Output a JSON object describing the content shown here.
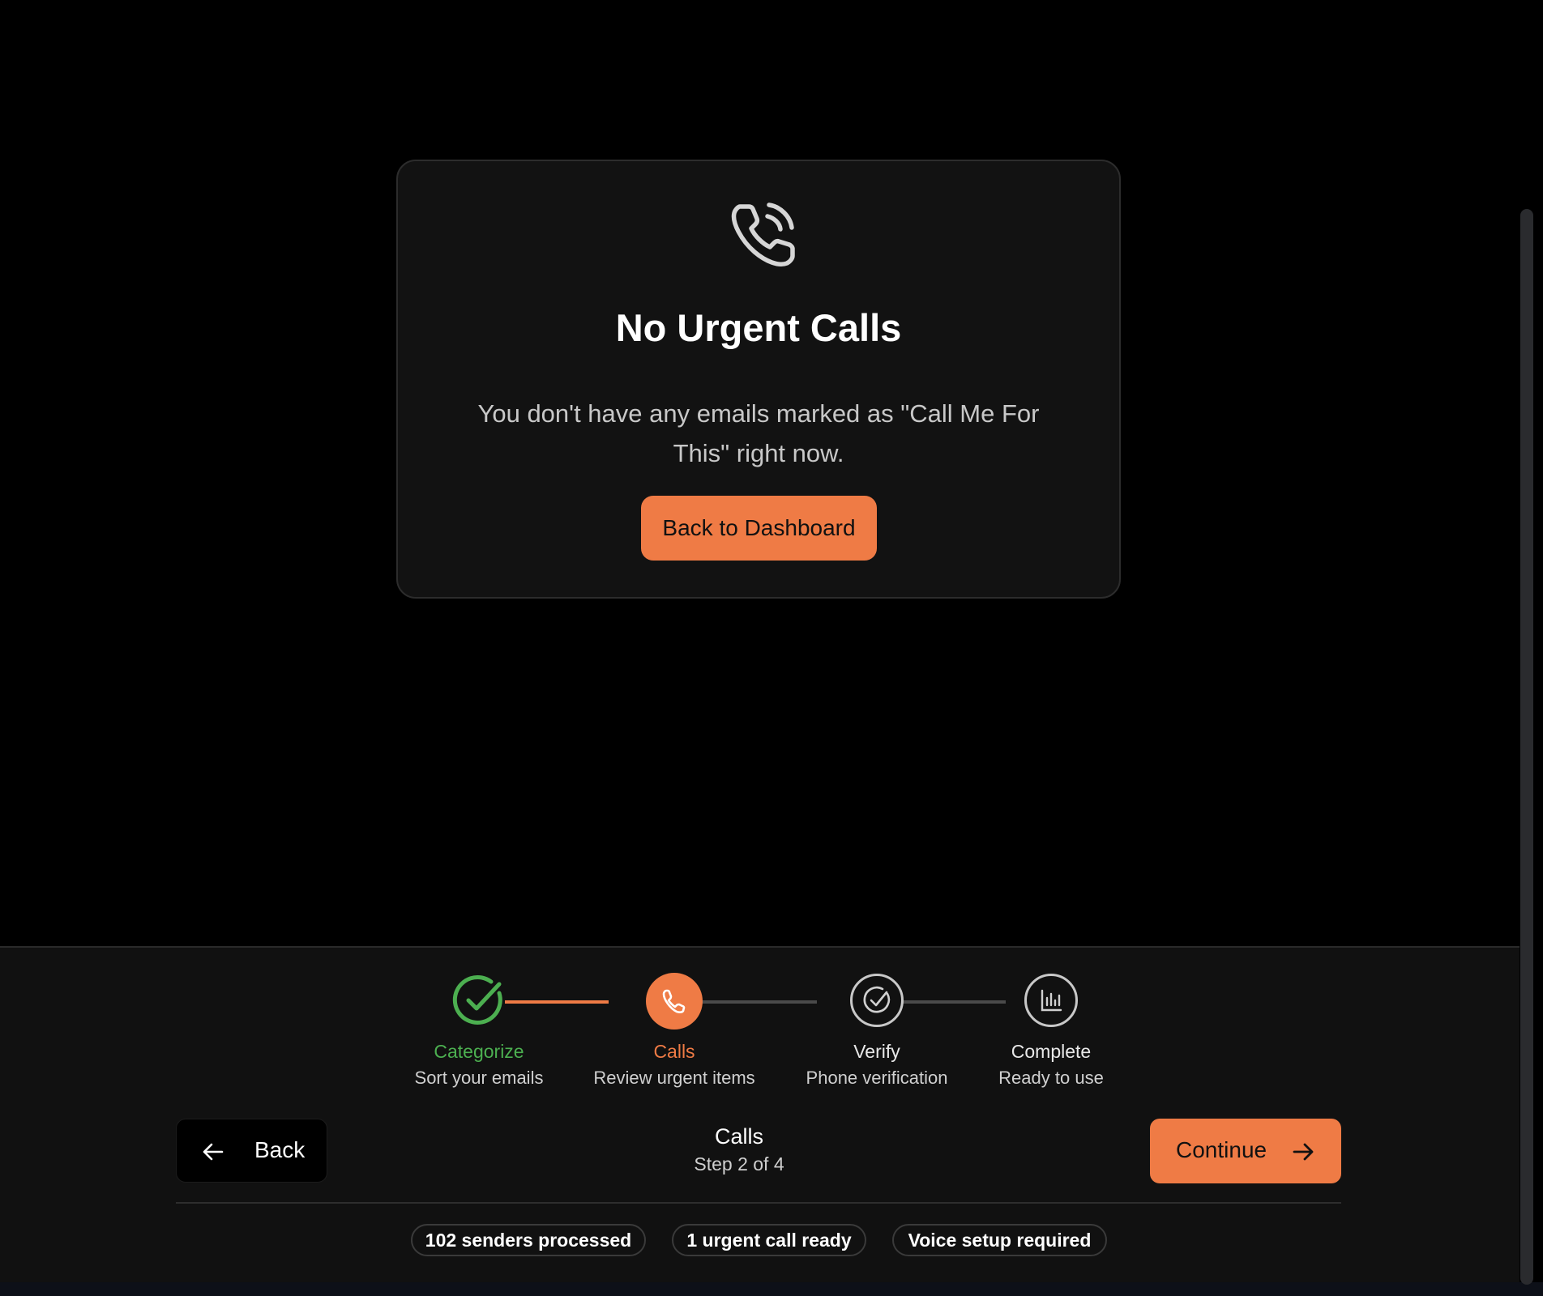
{
  "card": {
    "icon": "phone-call-icon",
    "title": "No Urgent Calls",
    "body": "You don't have any emails marked as \"Call Me For This\" right now.",
    "button_label": "Back to Dashboard"
  },
  "stepper": {
    "steps": [
      {
        "name": "Categorize",
        "description": "Sort your emails",
        "icon": "check-circle-icon",
        "state": "completed"
      },
      {
        "name": "Calls",
        "description": "Review urgent items",
        "icon": "phone-icon",
        "state": "active"
      },
      {
        "name": "Verify",
        "description": "Phone verification",
        "icon": "check-circle-icon",
        "state": "pending"
      },
      {
        "name": "Complete",
        "description": "Ready to use",
        "icon": "bar-chart-icon",
        "state": "pending"
      }
    ]
  },
  "nav": {
    "back_label": "Back",
    "title": "Calls",
    "subtitle": "Step 2 of 4",
    "continue_label": "Continue"
  },
  "status_pills": [
    "102 senders processed",
    "1 urgent call ready",
    "Voice setup required"
  ],
  "colors": {
    "accent": "#ef7b45",
    "success": "#4caf50",
    "background": "#000000",
    "panel": "#111111",
    "card": "#121212"
  }
}
